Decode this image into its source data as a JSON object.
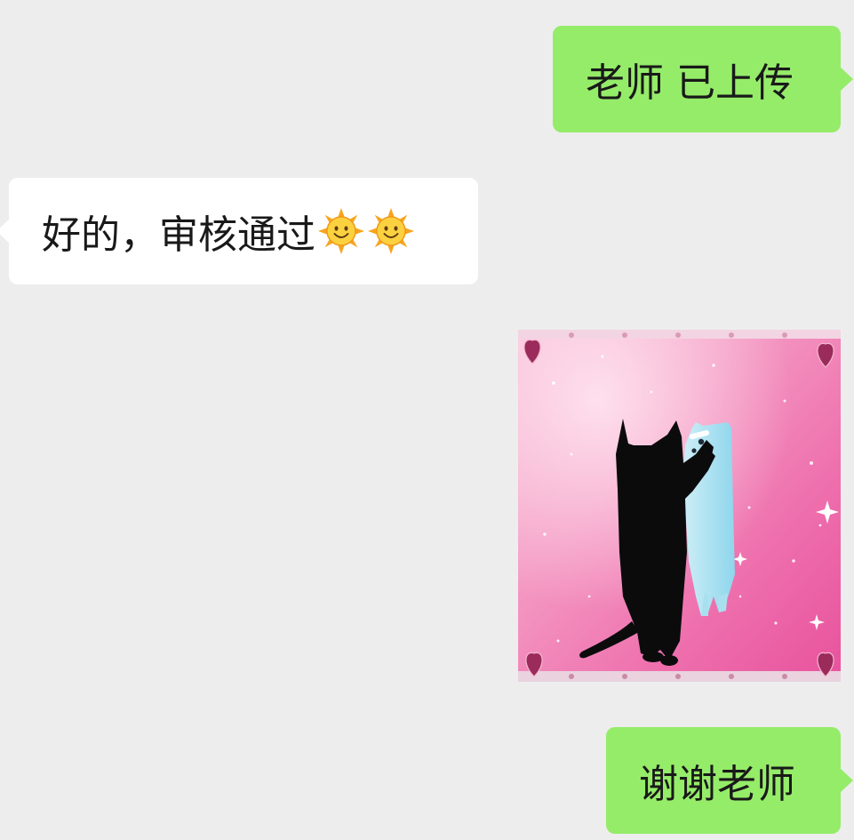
{
  "messages": [
    {
      "id": "msg1",
      "side": "right",
      "type": "text",
      "text": "老师 已上传"
    },
    {
      "id": "msg2",
      "side": "left",
      "type": "text",
      "text": "好的，审核通过",
      "emoji": [
        "sun-with-face",
        "sun-with-face"
      ]
    },
    {
      "id": "msg3",
      "side": "right",
      "type": "sticker",
      "subject": "black cat pawing at light-blue cat on pink sparkly background with heart corners"
    },
    {
      "id": "msg4",
      "side": "right",
      "type": "text",
      "text": "谢谢老师"
    }
  ],
  "colors": {
    "background": "#ededed",
    "my_bubble": "#95ec69",
    "their_bubble": "#ffffff",
    "text": "#191919"
  }
}
